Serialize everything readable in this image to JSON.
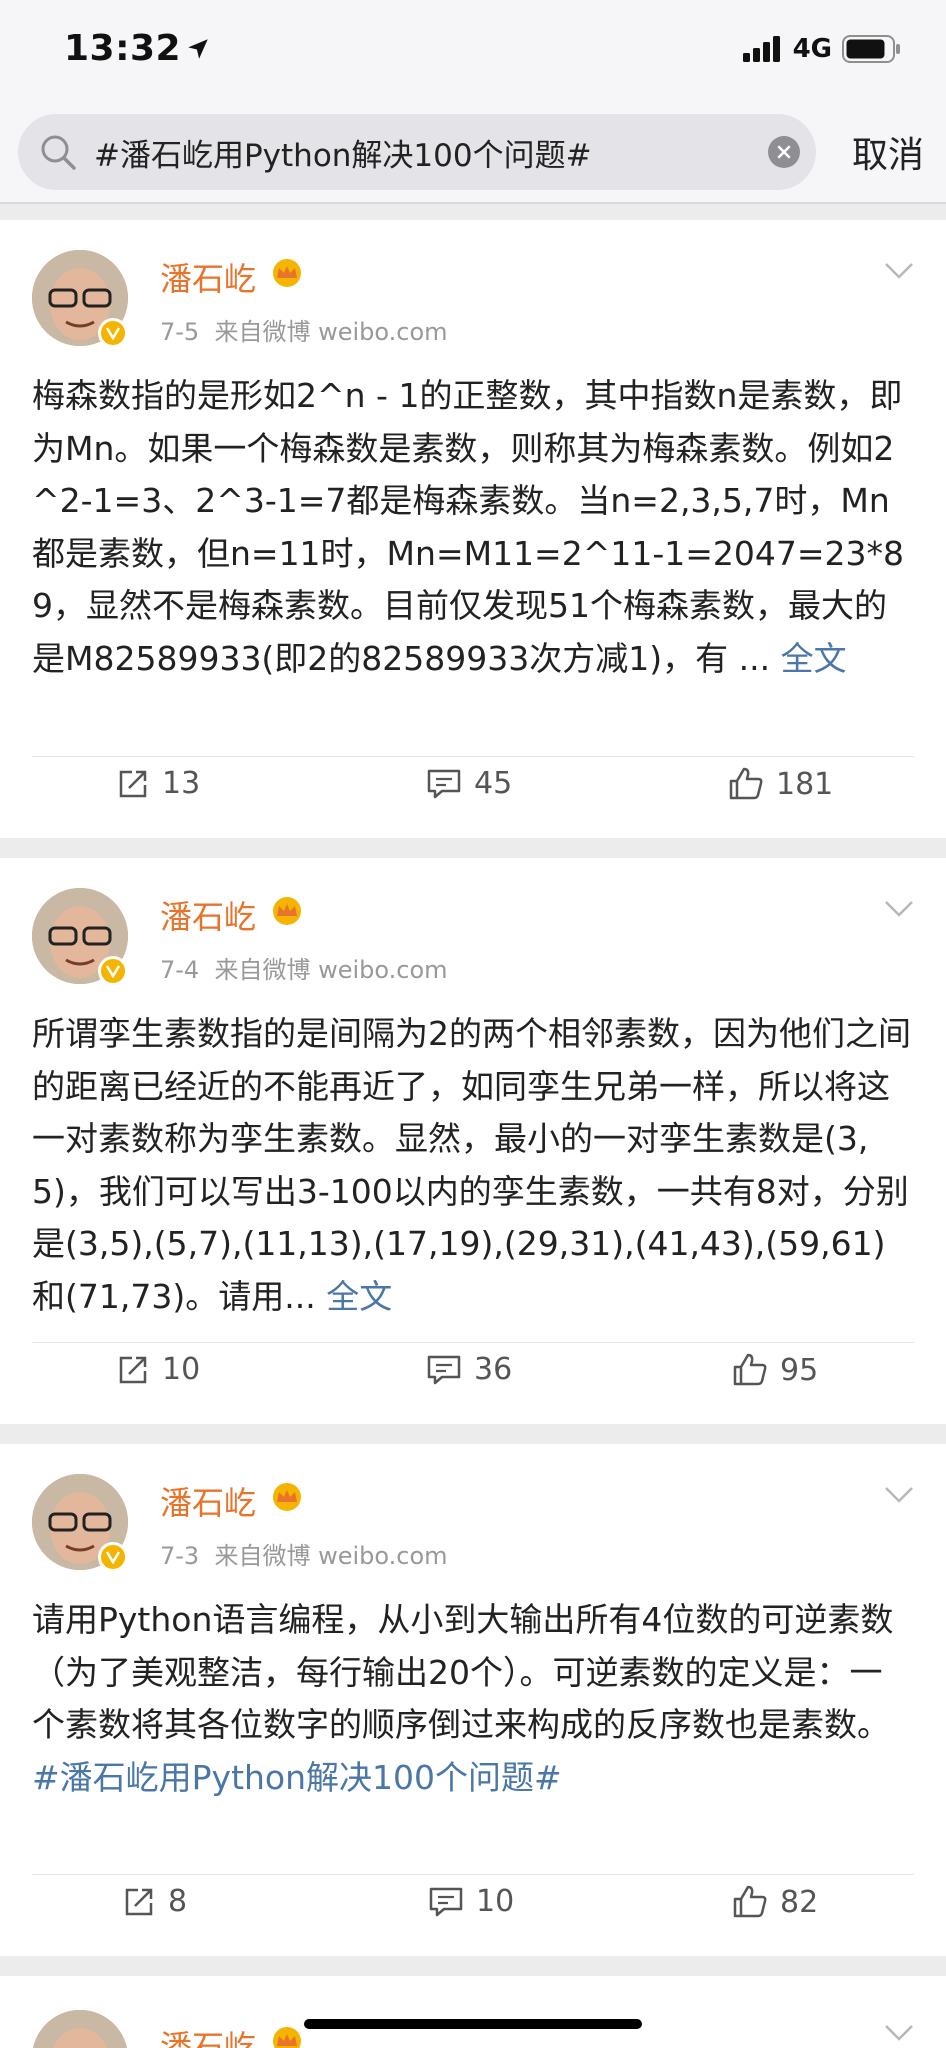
{
  "status_bar": {
    "time": "13:32",
    "network": "4G"
  },
  "search": {
    "query": "#潘石屹用Python解决100个问题#",
    "cancel_label": "取消"
  },
  "posts": [
    {
      "user": "潘石屹",
      "date": "7-5",
      "source": "来自微博 weibo.com",
      "text": "梅森数指的是形如2^n - 1的正整数，其中指数n是素数，即为Mn。如果一个梅森数是素数，则称其为梅森素数。例如2^2-1=3、2^3-1=7都是梅森素数。当n=2,3,5,7时，Mn都是素数，但n=11时，Mn=M11=2^11-1=2047=23*89，显然不是梅森素数。目前仅发现51个梅森素数，最大的是M82589933(即2的82589933次方减1)，有 ...",
      "more_link": "全文",
      "reposts": "13",
      "comments": "45",
      "likes": "181"
    },
    {
      "user": "潘石屹",
      "date": "7-4",
      "source": "来自微博 weibo.com",
      "text": "所谓孪生素数指的是间隔为2的两个相邻素数，因为他们之间的距离已经近的不能再近了，如同孪生兄弟一样，所以将这一对素数称为孪生素数。显然，最小的一对孪生素数是(3,5)，我们可以写出3-100以内的孪生素数，一共有8对，分别是(3,5),(5,7),(11,13),(17,19),(29,31),(41,43),(59,61)和(71,73)。请用...",
      "more_link": "全文",
      "reposts": "10",
      "comments": "36",
      "likes": "95"
    },
    {
      "user": "潘石屹",
      "date": "7-3",
      "source": "来自微博 weibo.com",
      "text": "请用Python语言编程，从小到大输出所有4位数的可逆素数（为了美观整洁，每行输出20个）。可逆素数的定义是：一个素数将其各位数字的顺序倒过来构成的反序数也是素数。",
      "hashtag": "#潘石屹用Python解决100个问题#",
      "reposts": "8",
      "comments": "10",
      "likes": "82"
    },
    {
      "user": "潘石屹"
    }
  ]
}
